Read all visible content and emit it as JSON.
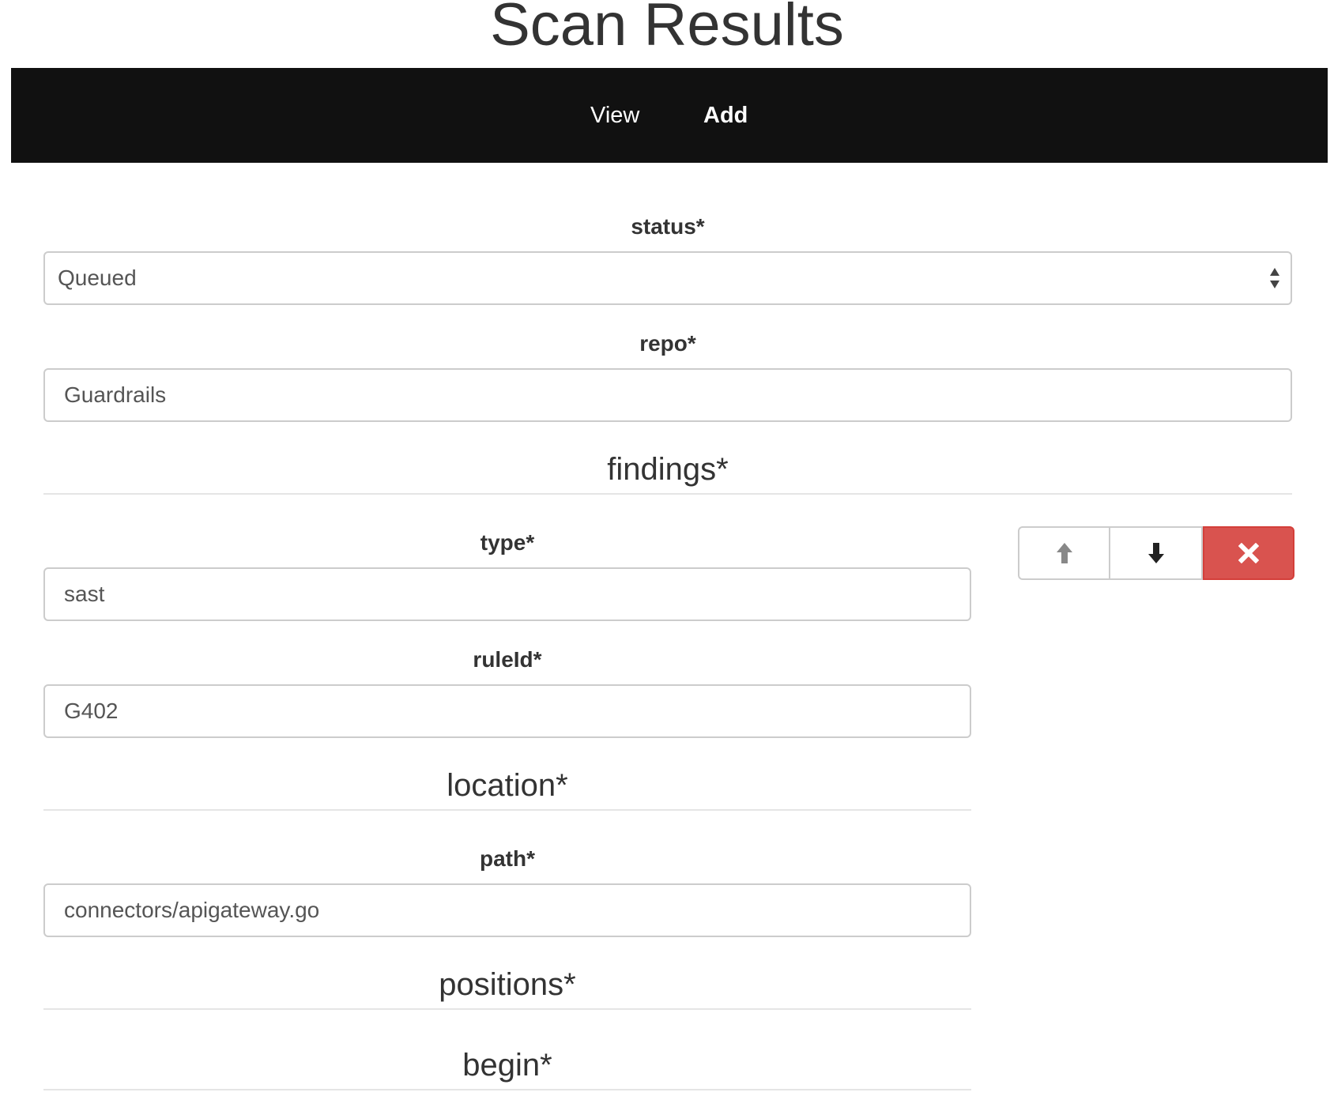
{
  "page": {
    "title": "Scan Results"
  },
  "nav": {
    "items": [
      {
        "label": "View"
      },
      {
        "label": "Add"
      }
    ]
  },
  "form": {
    "status": {
      "label": "status*",
      "value": "Queued"
    },
    "repo": {
      "label": "repo*",
      "value": "Guardrails"
    },
    "findings": {
      "legend": "findings*",
      "item": {
        "type": {
          "label": "type*",
          "value": "sast"
        },
        "ruleId": {
          "label": "ruleId*",
          "value": "G402"
        },
        "location": {
          "legend": "location*",
          "path": {
            "label": "path*",
            "value": "connectors/apigateway.go"
          },
          "positions": {
            "legend": "positions*",
            "begin": {
              "legend": "begin*"
            }
          }
        }
      },
      "controls": {
        "move_up_icon": "arrow-up-icon",
        "move_down_icon": "arrow-down-icon",
        "remove_icon": "close-icon",
        "remove_color": "#d9534f"
      }
    }
  }
}
